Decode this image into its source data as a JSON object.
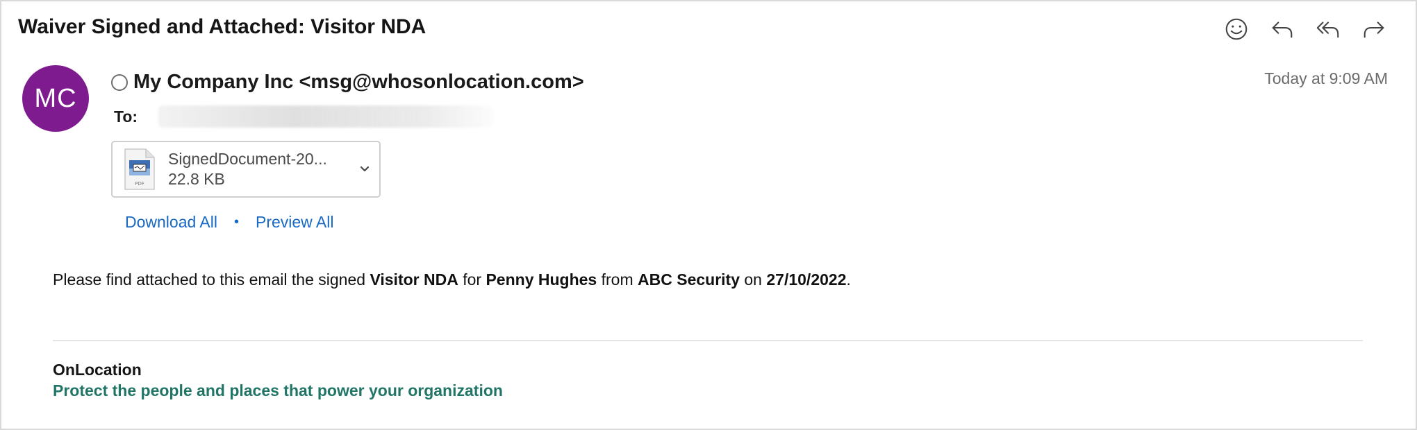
{
  "email": {
    "subject": "Waiver Signed and Attached: Visitor NDA",
    "sender": {
      "initials": "MC",
      "display": "My Company Inc <msg@whosonlocation.com>",
      "avatar_color": "#7e1c8f"
    },
    "timestamp": "Today at 9:09 AM",
    "to_label": "To:",
    "toolbar_icons": [
      "emoji-icon",
      "reply-icon",
      "reply-all-icon",
      "forward-icon"
    ],
    "attachment": {
      "name": "SignedDocument-20...",
      "size": "22.8 KB",
      "icon_label": "PDF"
    },
    "attachment_links": {
      "download_all": "Download All",
      "separator": "•",
      "preview_all": "Preview All"
    },
    "body": {
      "t1": "Please find attached to this email the signed ",
      "document": "Visitor NDA",
      "t2": " for ",
      "person": "Penny Hughes",
      "t3": " from ",
      "company": "ABC Security",
      "t4": " on ",
      "date": "27/10/2022",
      "t5": "."
    },
    "signature": {
      "name": "OnLocation",
      "tagline": "Protect the people and places that power your organization",
      "tagline_color": "#207566"
    },
    "link_color": "#1769c4"
  }
}
